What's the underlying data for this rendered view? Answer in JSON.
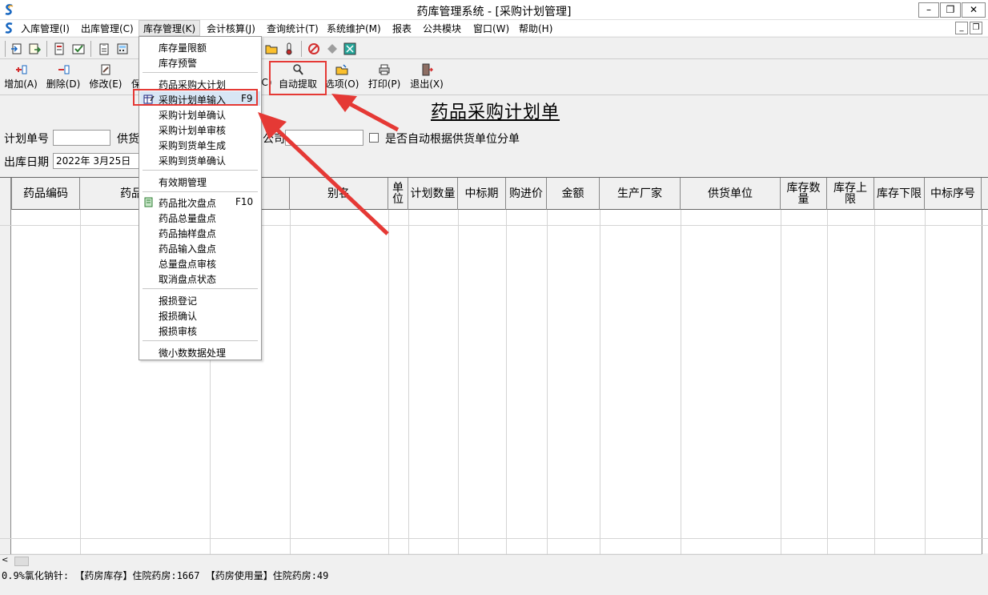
{
  "window": {
    "title": "药库管理系统 - [采购计划管理]",
    "minimize": "–",
    "restore": "❐",
    "close": "✕"
  },
  "menubar": {
    "items": [
      "入库管理(I)",
      "出库管理(C)",
      "库存管理(K)",
      "会计核算(J)",
      "查询统计(T)",
      "系统维护(M)",
      "报表",
      "公共模块",
      "窗口(W)",
      "帮助(H)"
    ],
    "mdi_minimize": "_",
    "mdi_restore": "❐"
  },
  "action_toolbar": {
    "add": "增加(A)",
    "delete": "删除(D)",
    "modify": "修改(E)",
    "save_partial": "保",
    "partial_c": "C)",
    "auto_extract": "自动提取",
    "options": "选项(O)",
    "print": "打印(P)",
    "exit": "退出(X)"
  },
  "form": {
    "title": "药品采购计划单",
    "plan_no_label": "计划单号",
    "plan_no_value": "",
    "supplier_label_partial": "供货",
    "company_label_partial": "公司",
    "auto_split_label": "是否自动根据供货单位分单",
    "auto_split_checked": false,
    "out_date_label": "出库日期",
    "out_date_value": "2022年  3月25日"
  },
  "grid": {
    "columns": [
      "药品编码",
      "药品",
      "别名",
      "单位",
      "计划数量",
      "中标期",
      "购进价",
      "金额",
      "生产厂家",
      "供货单位",
      "库存数量",
      "库存上限",
      "库存下限",
      "中标序号"
    ]
  },
  "status": {
    "text": "0.9%氯化钠针: 【药房库存】住院药房:1667    【药房使用量】住院药房:49"
  },
  "dropdown": {
    "menu": "库存管理(K)",
    "items": [
      {
        "label": "库存量限额"
      },
      {
        "label": "库存预警"
      },
      {
        "label": "药品采购大计划"
      },
      {
        "label": "采购计划单输入",
        "shortcut": "F9",
        "highlighted": true
      },
      {
        "label": "采购计划单确认"
      },
      {
        "label": "采购计划单审核"
      },
      {
        "label": "采购到货单生成"
      },
      {
        "label": "采购到货单确认"
      },
      {
        "label": "有效期管理"
      },
      {
        "label": "药品批次盘点",
        "shortcut": "F10"
      },
      {
        "label": "药品总量盘点"
      },
      {
        "label": "药品抽样盘点"
      },
      {
        "label": "药品输入盘点"
      },
      {
        "label": "总量盘点审核"
      },
      {
        "label": "取消盘点状态"
      },
      {
        "label": "报损登记"
      },
      {
        "label": "报损确认"
      },
      {
        "label": "报损审核"
      },
      {
        "label": "微小数数据处理"
      }
    ]
  },
  "colors": {
    "annotation_red": "#e53935"
  }
}
